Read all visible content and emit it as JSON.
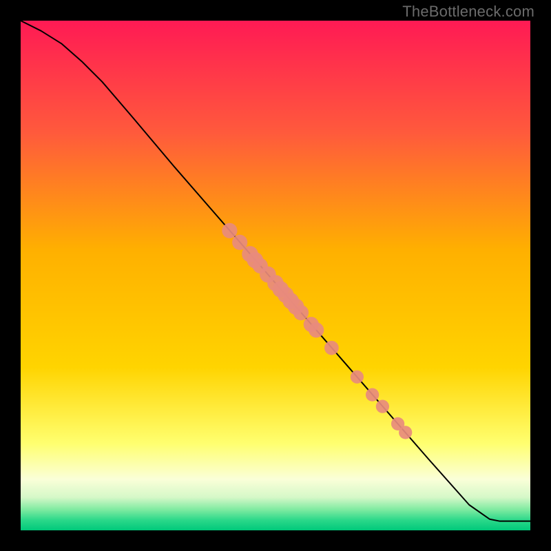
{
  "watermark": "TheBottleneck.com",
  "colors": {
    "black": "#000000",
    "line": "#000000",
    "point_fill": "#e88b7d",
    "gradient_top": "#ff1a54",
    "gradient_mid_upper": "#ff7a3a",
    "gradient_mid": "#ffd400",
    "gradient_pale1": "#ffff9a",
    "gradient_pale2": "#fafff0",
    "gradient_green1": "#b8f5b0",
    "gradient_green2": "#2edb7a",
    "gradient_green3": "#00c97a"
  },
  "chart_data": {
    "type": "line",
    "title": "",
    "xlabel": "",
    "ylabel": "",
    "xlim": [
      0,
      100
    ],
    "ylim": [
      0,
      100
    ],
    "curve": [
      {
        "x": 0,
        "y": 100
      },
      {
        "x": 4,
        "y": 98
      },
      {
        "x": 8,
        "y": 95.5
      },
      {
        "x": 12,
        "y": 92
      },
      {
        "x": 16,
        "y": 88
      },
      {
        "x": 22,
        "y": 81
      },
      {
        "x": 30,
        "y": 71.5
      },
      {
        "x": 40,
        "y": 60
      },
      {
        "x": 50,
        "y": 48.5
      },
      {
        "x": 60,
        "y": 37
      },
      {
        "x": 70,
        "y": 25.5
      },
      {
        "x": 80,
        "y": 14
      },
      {
        "x": 88,
        "y": 5
      },
      {
        "x": 92,
        "y": 2.2
      },
      {
        "x": 94,
        "y": 1.8
      },
      {
        "x": 100,
        "y": 1.8
      }
    ],
    "points": [
      {
        "x": 41,
        "y": 58.8,
        "r": 1.5
      },
      {
        "x": 43,
        "y": 56.5,
        "r": 1.5
      },
      {
        "x": 45,
        "y": 54.2,
        "r": 1.6
      },
      {
        "x": 46,
        "y": 53.0,
        "r": 1.6
      },
      {
        "x": 47,
        "y": 51.9,
        "r": 1.5
      },
      {
        "x": 48.5,
        "y": 50.2,
        "r": 1.6
      },
      {
        "x": 50,
        "y": 48.5,
        "r": 1.6
      },
      {
        "x": 51,
        "y": 47.3,
        "r": 1.6
      },
      {
        "x": 52,
        "y": 46.2,
        "r": 1.6
      },
      {
        "x": 53,
        "y": 45.0,
        "r": 1.6
      },
      {
        "x": 54,
        "y": 43.9,
        "r": 1.6
      },
      {
        "x": 55,
        "y": 42.7,
        "r": 1.5
      },
      {
        "x": 57,
        "y": 40.4,
        "r": 1.5
      },
      {
        "x": 58,
        "y": 39.3,
        "r": 1.5
      },
      {
        "x": 61,
        "y": 35.8,
        "r": 1.4
      },
      {
        "x": 66,
        "y": 30.1,
        "r": 1.3
      },
      {
        "x": 69,
        "y": 26.6,
        "r": 1.3
      },
      {
        "x": 71,
        "y": 24.3,
        "r": 1.3
      },
      {
        "x": 74,
        "y": 20.9,
        "r": 1.3
      },
      {
        "x": 75.5,
        "y": 19.2,
        "r": 1.3
      }
    ]
  }
}
